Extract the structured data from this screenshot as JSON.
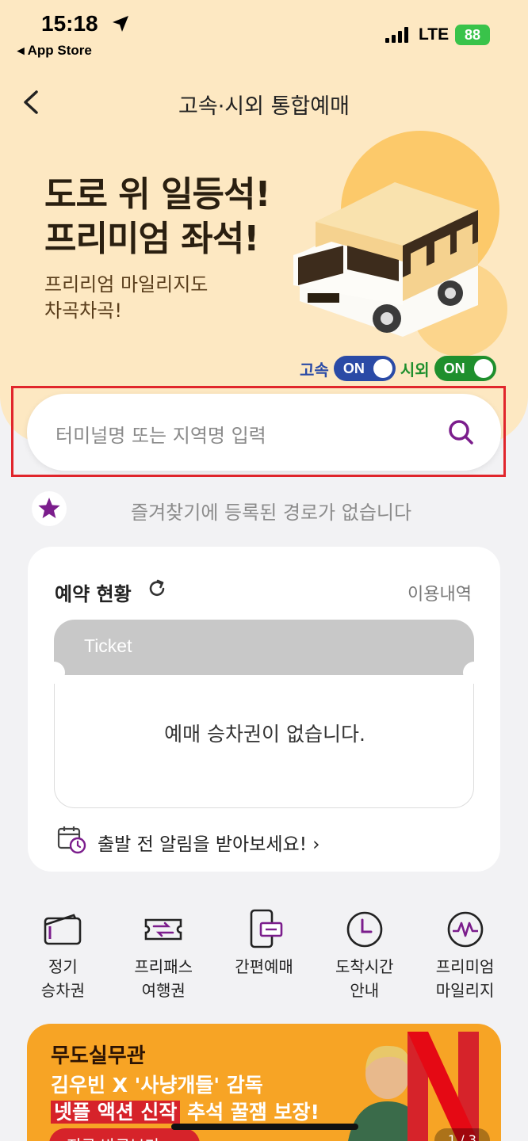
{
  "status_bar": {
    "time": "15:18",
    "back_app": "◂ App Store",
    "network": "LTE",
    "battery": "88"
  },
  "header": {
    "title": "고속·시외 통합예매"
  },
  "hero": {
    "title_line1": "도로 위 일등석!",
    "title_line2": "프리미엄 좌석!",
    "sub_line1": "프리리엄 마일리지도",
    "sub_line2": "차곡차곡!"
  },
  "toggles": [
    {
      "label": "고속",
      "state": "ON"
    },
    {
      "label": "시외",
      "state": "ON"
    }
  ],
  "search": {
    "placeholder": "터미널명 또는 지역명 입력"
  },
  "favorites": {
    "empty_text": "즐겨찾기에 등록된 경로가 없습니다"
  },
  "reservation": {
    "title": "예약 현황",
    "history_link": "이용내역",
    "ticket_label": "Ticket",
    "empty_text": "예매 승차권이 없습니다.",
    "alarm_text": "출발 전 알림을 받아보세요! ›"
  },
  "menu": [
    {
      "line1": "정기",
      "line2": "승차권",
      "icon": "wallet-icon"
    },
    {
      "line1": "프리패스",
      "line2": "여행권",
      "icon": "ticket-pass-icon"
    },
    {
      "line1": "간편예매",
      "line2": "",
      "icon": "phone-ticket-icon"
    },
    {
      "line1": "도착시간",
      "line2": "안내",
      "icon": "clock-icon"
    },
    {
      "line1": "프리미엄",
      "line2": "마일리지",
      "icon": "mileage-icon"
    }
  ],
  "banner": {
    "brand": "무도실무관",
    "line1": "김우빈 X '사냥개들' 감독",
    "line2_highlight": "넷플 액션 신작",
    "line2_rest": " 추석 꿀잼 보장!",
    "cta": "지금 바로보기 ›",
    "page": "1 / 3"
  },
  "colors": {
    "accent": "#7b1d8c",
    "hero_bg": "#fde8c2",
    "highlight_red": "#e1262c",
    "express_blue": "#2a4aa6",
    "intercity_green": "#1f8f2d"
  }
}
